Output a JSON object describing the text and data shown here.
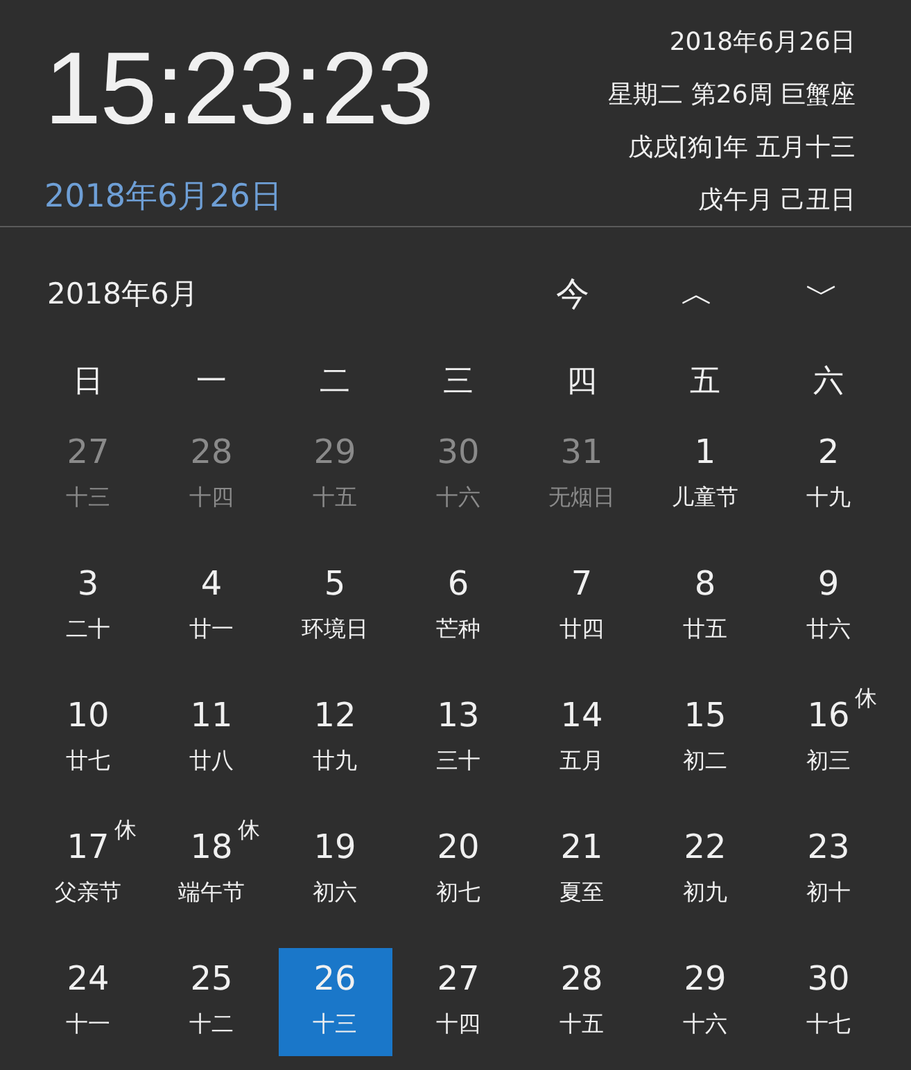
{
  "clock": {
    "time": "15:23:23",
    "date_link": "2018年6月26日"
  },
  "info_lines": [
    "2018年6月26日",
    "星期二 第26周 巨蟹座",
    "戊戌[狗]年 五月十三",
    "戊午月 己丑日"
  ],
  "calendar": {
    "month_label": "2018年6月",
    "today_button": "今",
    "prev_button": "︿",
    "next_button": "﹀",
    "weekdays": [
      "日",
      "一",
      "二",
      "三",
      "四",
      "五",
      "六"
    ],
    "days": [
      {
        "day": "27",
        "sub": "十三",
        "other_month": true,
        "selected": false
      },
      {
        "day": "28",
        "sub": "十四",
        "other_month": true,
        "selected": false
      },
      {
        "day": "29",
        "sub": "十五",
        "other_month": true,
        "selected": false
      },
      {
        "day": "30",
        "sub": "十六",
        "other_month": true,
        "selected": false
      },
      {
        "day": "31",
        "sub": "无烟日",
        "other_month": true,
        "selected": false
      },
      {
        "day": "1",
        "sub": "儿童节",
        "other_month": false,
        "selected": false
      },
      {
        "day": "2",
        "sub": "十九",
        "other_month": false,
        "selected": false
      },
      {
        "day": "3",
        "sub": "二十",
        "other_month": false,
        "selected": false
      },
      {
        "day": "4",
        "sub": "廿一",
        "other_month": false,
        "selected": false
      },
      {
        "day": "5",
        "sub": "环境日",
        "other_month": false,
        "selected": false
      },
      {
        "day": "6",
        "sub": "芒种",
        "other_month": false,
        "selected": false
      },
      {
        "day": "7",
        "sub": "廿四",
        "other_month": false,
        "selected": false
      },
      {
        "day": "8",
        "sub": "廿五",
        "other_month": false,
        "selected": false
      },
      {
        "day": "9",
        "sub": "廿六",
        "other_month": false,
        "selected": false
      },
      {
        "day": "10",
        "sub": "廿七",
        "other_month": false,
        "selected": false
      },
      {
        "day": "11",
        "sub": "廿八",
        "other_month": false,
        "selected": false
      },
      {
        "day": "12",
        "sub": "廿九",
        "other_month": false,
        "selected": false
      },
      {
        "day": "13",
        "sub": "三十",
        "other_month": false,
        "selected": false
      },
      {
        "day": "14",
        "sub": "五月",
        "other_month": false,
        "selected": false
      },
      {
        "day": "15",
        "sub": "初二",
        "other_month": false,
        "selected": false
      },
      {
        "day": "16",
        "sub": "初三",
        "other_month": false,
        "holiday": "休",
        "selected": false
      },
      {
        "day": "17",
        "sub": "父亲节",
        "other_month": false,
        "holiday": "休",
        "selected": false
      },
      {
        "day": "18",
        "sub": "端午节",
        "other_month": false,
        "holiday": "休",
        "selected": false
      },
      {
        "day": "19",
        "sub": "初六",
        "other_month": false,
        "selected": false
      },
      {
        "day": "20",
        "sub": "初七",
        "other_month": false,
        "selected": false
      },
      {
        "day": "21",
        "sub": "夏至",
        "other_month": false,
        "selected": false
      },
      {
        "day": "22",
        "sub": "初九",
        "other_month": false,
        "selected": false
      },
      {
        "day": "23",
        "sub": "初十",
        "other_month": false,
        "selected": false
      },
      {
        "day": "24",
        "sub": "十一",
        "other_month": false,
        "selected": false
      },
      {
        "day": "25",
        "sub": "十二",
        "other_month": false,
        "selected": false
      },
      {
        "day": "26",
        "sub": "十三",
        "other_month": false,
        "selected": true
      },
      {
        "day": "27",
        "sub": "十四",
        "other_month": false,
        "selected": false
      },
      {
        "day": "28",
        "sub": "十五",
        "other_month": false,
        "selected": false
      },
      {
        "day": "29",
        "sub": "十六",
        "other_month": false,
        "selected": false
      },
      {
        "day": "30",
        "sub": "十七",
        "other_month": false,
        "selected": false
      }
    ]
  }
}
